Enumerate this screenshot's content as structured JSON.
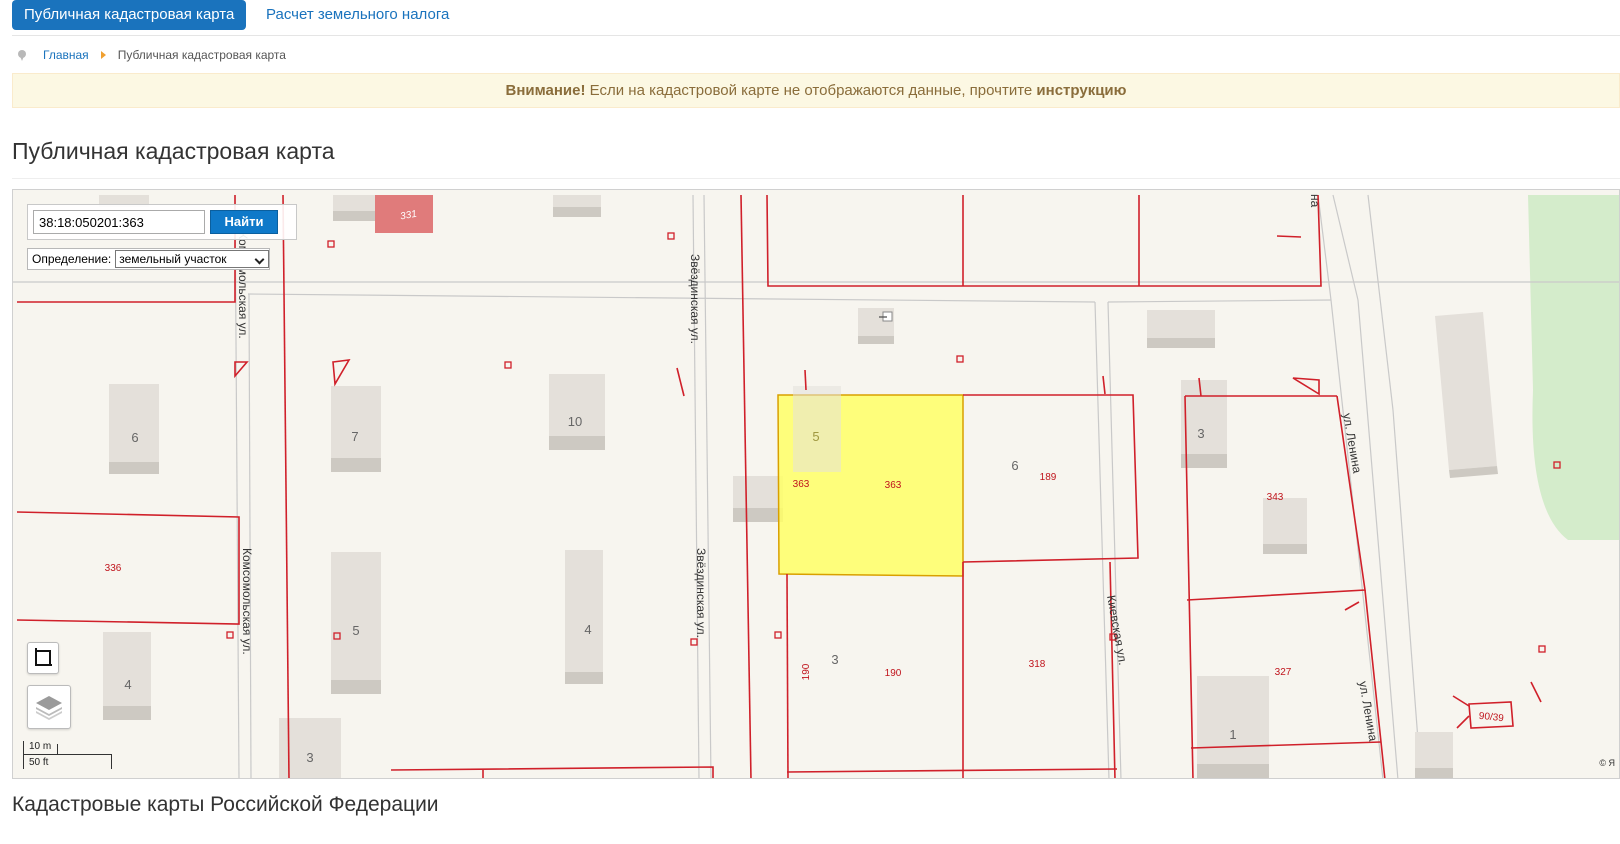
{
  "nav": {
    "tab_active": "Публичная кадастровая карта",
    "tab_tax": "Расчет земельного налога"
  },
  "breadcrumb": {
    "home": "Главная",
    "current": "Публичная кадастровая карта"
  },
  "alert": {
    "strong": "Внимание!",
    "text": " Если на кадастровой карте не отображаются данные, прочтите ",
    "link": "инструкцию"
  },
  "page_title": "Публичная кадастровая карта",
  "map": {
    "search_value": "38:18:050201:363",
    "search_button": "Найти",
    "definition_label": "Определение:",
    "definition_value": "земельный участок",
    "scale_metric": "10 m",
    "scale_imperial": "50 ft",
    "copyright": "© Я",
    "colors": {
      "background": "#f7f5ef",
      "parcel_line": "#d0202a",
      "selected_fill": "#ffff66",
      "building": "#e4e0da",
      "building_shade": "#cdc9c2",
      "park": "#d4eccb",
      "road_edge": "#c9c9c9"
    },
    "streets": {
      "komsomolskaya_top": "Комсомольская ул.",
      "komsomolskaya_bottom": "Комсомольская ул.",
      "zvezdinskaya_top": "Звёздинская ул.",
      "zvezdinskaya_bottom": "Звёздинская ул.",
      "kievskaya": "Киевская ул.",
      "lenina_top": "ул. Ленина",
      "lenina_bottom": "ул. Ленина",
      "top_right_fragment": "на"
    },
    "house_numbers": {
      "h6_left": "6",
      "h7": "7",
      "h10": "10",
      "h5_selected": "5",
      "h6_mid": "6",
      "h3_right": "3",
      "h5_left": "5",
      "h4_mid": "4",
      "h4_left": "4",
      "h3_mid": "3",
      "h3_bottom": "3",
      "h1": "1"
    },
    "parcel_numbers": {
      "p331": "331",
      "p363_a": "363",
      "p363_b": "363",
      "p189": "189",
      "p343": "343",
      "p336": "336",
      "p190_a": "190",
      "p190_b": "190",
      "p318": "318",
      "p327": "327",
      "p90_39": "90/39"
    },
    "icons": {
      "frame": "fullscreen-frame-icon",
      "layers": "layers-icon",
      "entrance": "entrance-icon"
    }
  },
  "footer_title": "Кадастровые карты Российской Федерации"
}
